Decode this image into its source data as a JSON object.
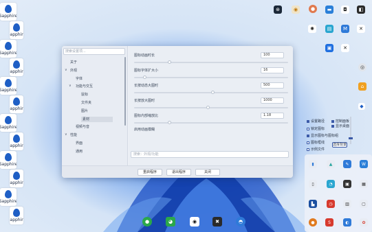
{
  "desktop": {
    "sapphire_label": "Sapphire",
    "sapphire_tiles": 12
  },
  "dialog": {
    "search_placeholder": "搜索设置项...",
    "tree": [
      {
        "label": "关于",
        "indent": 0,
        "arrow": ""
      },
      {
        "label": "外观",
        "indent": 0,
        "arrow": "∨"
      },
      {
        "label": "字体",
        "indent": 1,
        "arrow": ""
      },
      {
        "label": "功能与交互",
        "indent": 1,
        "arrow": "∨"
      },
      {
        "label": "鼠标",
        "indent": 2,
        "arrow": ""
      },
      {
        "label": "文件夹",
        "indent": 2,
        "arrow": ""
      },
      {
        "label": "图片",
        "indent": 2,
        "arrow": ""
      },
      {
        "label": "素材",
        "indent": 2,
        "arrow": ""
      },
      {
        "label": "视频与音",
        "indent": 1,
        "arrow": ""
      },
      {
        "label": "性能",
        "indent": 0,
        "arrow": "∨"
      },
      {
        "label": "界面",
        "indent": 1,
        "arrow": ""
      },
      {
        "label": "通用",
        "indent": 1,
        "arrow": ""
      }
    ],
    "rows": [
      {
        "label": "图标动画时长",
        "value": "100",
        "knob": 0.22
      },
      {
        "label": "图标字体扩大小",
        "value": "16",
        "knob": 0.06
      },
      {
        "label": "长按动态大图时",
        "value": "500",
        "knob": 0.5
      },
      {
        "label": "长按放大图时",
        "value": "1000",
        "knob": 0.47
      },
      {
        "label": "图标内部缩放比",
        "value": "1.18",
        "knob": 0.22
      }
    ],
    "extra_label": "启用动画模糊",
    "bottom_placeholder": "搜索：外观/功能",
    "buttons": {
      "reset": "重启程序",
      "exit": "退出程序",
      "close": "关闭"
    }
  },
  "panel": {
    "checks": [
      {
        "label": "设置路径",
        "on": true
      },
      {
        "label": "控制面板",
        "on": true
      },
      {
        "label": "锁定图标",
        "on": false
      },
      {
        "label": "显示桌面",
        "on": true
      },
      {
        "label": "显示图标与图标组",
        "on": true
      },
      {
        "label": "图标框线",
        "on": false
      },
      {
        "label": "示例文件",
        "on": false
      }
    ],
    "choose_button": "选择背景"
  },
  "colors": {
    "accent": "#3b5aa8",
    "steam": "#1b2838",
    "orange": "#e07a1f",
    "blue": "#2f7ad8",
    "teal": "#2aa6a0",
    "red": "#d73a2e",
    "green": "#2ba84a"
  },
  "taskbar": {
    "icons": [
      "wechat-icon",
      "wechat-green-icon",
      "qq-icon",
      "tool-icon",
      "edge-icon"
    ]
  }
}
